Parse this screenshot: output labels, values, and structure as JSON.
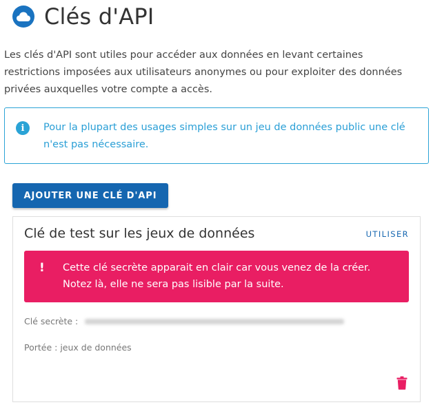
{
  "header": {
    "title": "Clés d'API",
    "icon": "cloud-icon"
  },
  "intro": {
    "text": "Les clés d'API sont utiles pour accéder aux données en levant certaines restrictions imposées aux utilisateurs anonymes ou pour exploiter des données privées auxquelles votre compte a accès."
  },
  "info": {
    "icon": "info-icon",
    "text": "Pour la plupart des usages simples sur un jeu de données public une clé n'est pas nécessaire."
  },
  "actions": {
    "add_label": "AJOUTER UNE CLÉ D'API"
  },
  "key_card": {
    "title": "Clé de test sur les jeux de données",
    "use_label": "UTILISER",
    "alert": {
      "icon": "exclamation-icon",
      "text": "Cette clé secrète apparait en clair car vous venez de la créer. Notez là, elle ne sera pas lisible par la suite."
    },
    "secret_label": "Clé secrète :",
    "scope_label": "Portée : jeux de données",
    "delete_icon": "trash-icon"
  },
  "colors": {
    "primary": "#1566b0",
    "info": "#2aa3d6",
    "alert": "#e91e63"
  }
}
